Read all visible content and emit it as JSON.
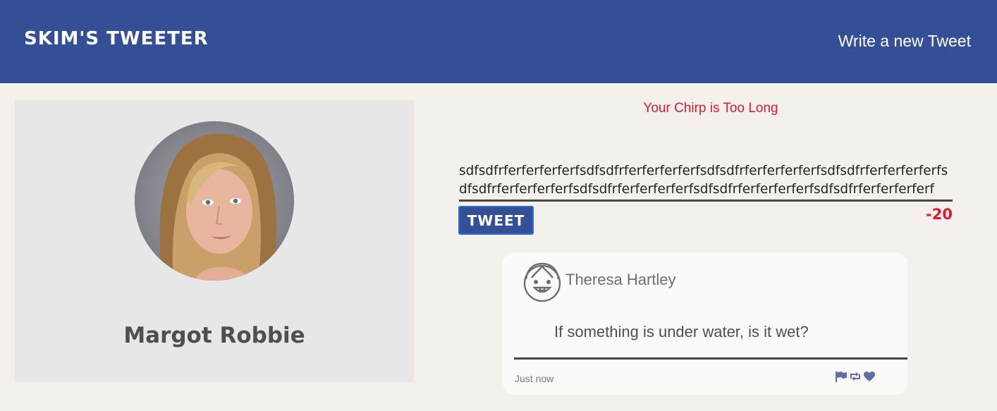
{
  "header": {
    "brand": "SKIM'S TWEETER",
    "compose_link": "Write a new Tweet"
  },
  "profile": {
    "name": "Margot Robbie",
    "avatar_icon": "profile-photo"
  },
  "composer": {
    "error_message": "Your Chirp is Too Long",
    "value": "sdfsdfrferferferferfsdfsdfrferferferferfsdfsdfrferferferferfsdfsdfrferferferferfsdfsdfrferferferferfsdfsdfrferferferferfsdfsdfrferferferferfsdfsdfrferferferferf",
    "button_label": "TWEET",
    "counter": "-20"
  },
  "tweet": {
    "author": "Theresa Hartley",
    "avatar_icon": "smiling-face-icon",
    "text": "If something is under water, is it wet?",
    "timestamp": "Just now",
    "actions": [
      "flag-icon",
      "retweet-icon",
      "heart-icon"
    ]
  },
  "colors": {
    "navbar": "#354f97",
    "background": "#f4f1ec",
    "error": "#e0182e",
    "card": "#fbfaf8"
  }
}
